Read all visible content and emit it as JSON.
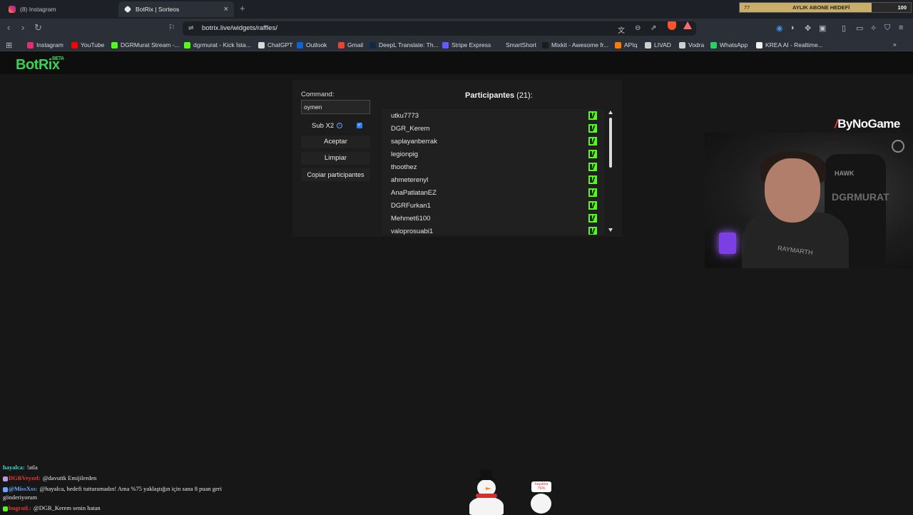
{
  "browser": {
    "tabs": [
      {
        "title": "(8) Instagram",
        "icon": "instagram-icon"
      },
      {
        "title": "BotRix | Sorteos",
        "icon": "botrix-icon",
        "active": true
      }
    ],
    "new_tab": "+",
    "close": "×",
    "url": "botrix.live/widgets/raffles/",
    "bookmarks": [
      {
        "label": "Instagram",
        "color": "#e1306c"
      },
      {
        "label": "YouTube",
        "color": "#ff0000"
      },
      {
        "label": "DGRMurat Stream -...",
        "color": "#53fc18"
      },
      {
        "label": "dgrmurat - Kick İsta...",
        "color": "#53fc18"
      },
      {
        "label": "ChatGPT",
        "color": "#d9d9d9"
      },
      {
        "label": "Outlook",
        "color": "#0a64d2"
      },
      {
        "label": "Gmail",
        "color": "#ea4335"
      },
      {
        "label": "DeepL Translate: Th...",
        "color": "#0f2b46"
      },
      {
        "label": "Stripe Express",
        "color": "#635bff"
      },
      {
        "label": "SmartShort",
        "color": "#2b3038"
      },
      {
        "label": "Mixkit - Awesome fr...",
        "color": "#1c1c1c"
      },
      {
        "label": "APIq",
        "color": "#ff7a00"
      },
      {
        "label": "LIVAD",
        "color": "#cfcfcf"
      },
      {
        "label": "Vodra",
        "color": "#cfcfcf"
      },
      {
        "label": "WhatsApp",
        "color": "#25d366"
      },
      {
        "label": "KREA AI - Realtime...",
        "color": "#f2f2f2"
      }
    ]
  },
  "sub_goal": {
    "current": "77",
    "label": "AYLIK ABONE HEDEFİ",
    "target": "100",
    "progress": 0.77
  },
  "app": {
    "logo": "BotRix",
    "logo_badge": "BETA"
  },
  "raffle": {
    "command_label": "Command:",
    "command_value": "oymen",
    "subx2_label": "Sub X2",
    "subx2_checked": true,
    "buttons": {
      "accept": "Aceptar",
      "clear": "Limpiar",
      "copy": "Copiar participantes"
    },
    "participants_title": "Participantes",
    "participants_count": "(21):",
    "participants": [
      "utku7773",
      "DGR_Kerem",
      "saplayanberrak",
      "legionpig",
      "thoothez",
      "ahmeterenyl",
      "AnaPatlatanEZ",
      "DGRFurkan1",
      "Mehmet6100",
      "valoprosuabi1"
    ]
  },
  "overlay": {
    "sponsor": "ByNoGame",
    "webcam_chair_brand": "HAWK",
    "webcam_chair_text": "DGRMURAT",
    "webcam_shirt_text": "RAYMARTH",
    "chat": [
      {
        "user": "hayalca:",
        "user_color": "#3fd6c4",
        "text": "!atla"
      },
      {
        "user": "DGRVeyzel:",
        "user_color": "#e53935",
        "text": "@davuttk Emijilerden"
      },
      {
        "user": "@MissXss:",
        "user_color": "#6aa6ff",
        "text": "@hayalca, hedefi tutturamadın! Ama %75 yaklaştığın için sana 8 puan geri"
      },
      {
        "user": "",
        "user_color": "#e8e8e8",
        "text": "gönderiyorum"
      },
      {
        "user": "bugratl.:",
        "user_color": "#e53935",
        "text": "@DGR_Kerem senin hatan"
      }
    ],
    "snowball_tag_user": "hayalca",
    "snowball_tag_value": "76%"
  }
}
